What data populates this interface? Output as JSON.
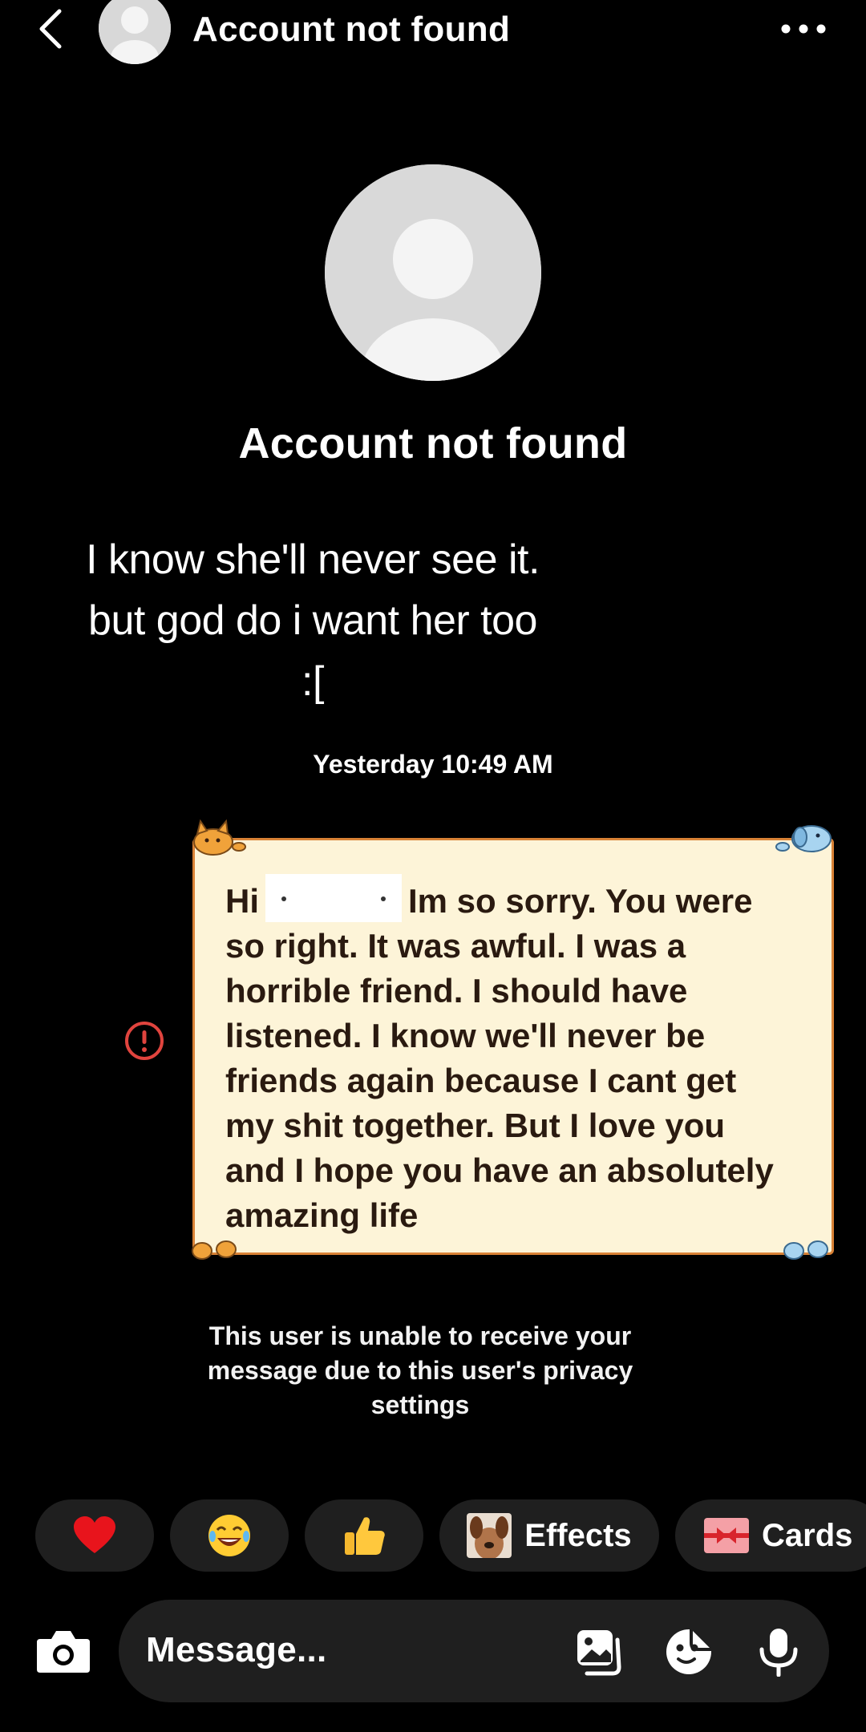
{
  "header": {
    "title": "Account not found"
  },
  "profile": {
    "name": "Account not found"
  },
  "caption": {
    "lines": [
      "I know she'll never see it.",
      "but god do i want her too",
      ":["
    ]
  },
  "conversation": {
    "timestamp": "Yesterday 10:49 AM",
    "message": {
      "greeting": "Hi",
      "lines": [
        "Im so sorry. You were",
        "so right. It was awful. I was a",
        "horrible friend. I should have",
        "listened. I know we'll never be",
        "friends again because I cant get",
        "my shit together. But I love you",
        "and I hope you have an absolutely",
        "amazing life"
      ],
      "status": "error"
    },
    "privacy_note": [
      "This user is unable to receive your",
      "message due to this user's privacy",
      "settings"
    ]
  },
  "quick_reactions": [
    {
      "emoji": "❤️",
      "icon": "heart-icon"
    },
    {
      "emoji": "😂",
      "icon": "laughing-face-icon"
    },
    {
      "emoji": "👍",
      "icon": "thumbs-up-icon"
    }
  ],
  "chips": {
    "effects_label": "Effects",
    "cards_label": "Cards"
  },
  "composer": {
    "placeholder": "Message..."
  },
  "colors": {
    "background": "#000000",
    "chip_bg": "#1f1f1f",
    "card_bg": "#fdf4d8",
    "card_border": "#d98236",
    "error": "#e0443e"
  }
}
